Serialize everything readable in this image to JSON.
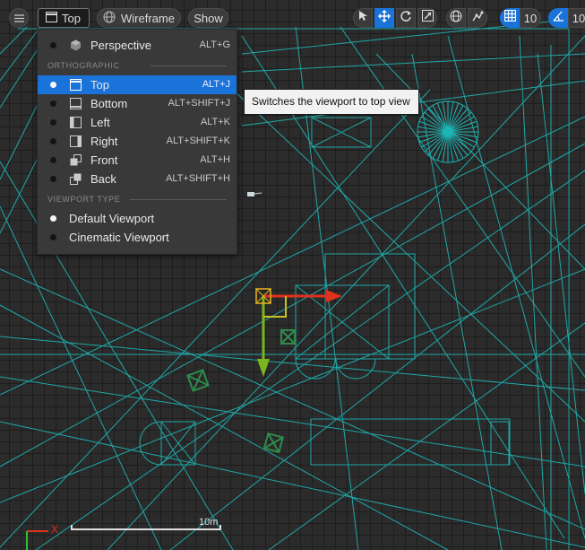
{
  "toolbar": {
    "menu_icon": "hamburger-icon",
    "view_mode_label": "Top",
    "view_mode_icon": "top-view-icon",
    "render_mode_label": "Wireframe",
    "render_mode_icon": "globe-wireframe-icon",
    "show_label": "Show",
    "right_tools": [
      "select-arrow-icon",
      "translate-icon",
      "rotate-icon",
      "scale-icon",
      "world-local-icon",
      "surface-snap-icon",
      "grid-snap-icon",
      "rotation-snap-icon"
    ],
    "grid_snap_value": "10",
    "rotation_snap_value": "10",
    "accent_color": "#1a73d9"
  },
  "view_menu": {
    "perspective": {
      "label": "Perspective",
      "shortcut": "ALT+G",
      "icon": "perspective-cube-icon"
    },
    "orthographic_header": "ORTHOGRAPHIC",
    "orthographic": [
      {
        "label": "Top",
        "shortcut": "ALT+J",
        "icon": "top-view-icon",
        "selected": true
      },
      {
        "label": "Bottom",
        "shortcut": "ALT+SHIFT+J",
        "icon": "bottom-view-icon",
        "selected": false
      },
      {
        "label": "Left",
        "shortcut": "ALT+K",
        "icon": "left-view-icon",
        "selected": false
      },
      {
        "label": "Right",
        "shortcut": "ALT+SHIFT+K",
        "icon": "right-view-icon",
        "selected": false
      },
      {
        "label": "Front",
        "shortcut": "ALT+H",
        "icon": "front-view-icon",
        "selected": false
      },
      {
        "label": "Back",
        "shortcut": "ALT+SHIFT+H",
        "icon": "back-view-icon",
        "selected": false
      }
    ],
    "viewport_type_header": "VIEWPORT TYPE",
    "viewport_types": [
      {
        "label": "Default Viewport",
        "selected": true
      },
      {
        "label": "Cinematic Viewport",
        "selected": false
      }
    ]
  },
  "tooltip": {
    "text": "Switches the viewport to top view"
  },
  "scale_bar": {
    "label": "10m"
  },
  "axis_indicator": {
    "x_label": "X"
  },
  "colors": {
    "wireframe": "#1fb5b5",
    "x_axis": "#e0301e",
    "y_axis": "#7ab51d",
    "selection": "#e8b620",
    "grid_bg": "#2b2b2b"
  }
}
